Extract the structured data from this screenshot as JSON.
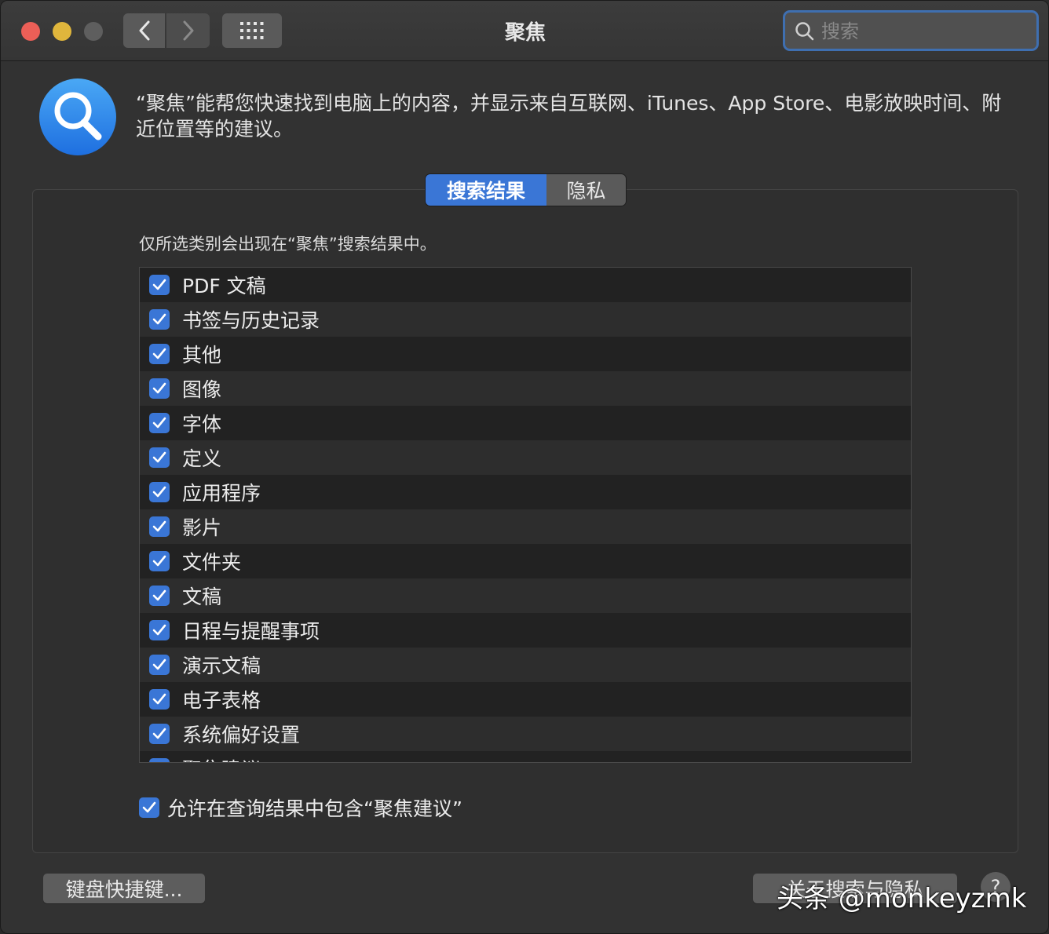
{
  "window": {
    "title": "聚焦"
  },
  "search": {
    "placeholder": "搜索",
    "value": ""
  },
  "header": {
    "description": "“聚焦”能帮您快速找到电脑上的内容，并显示来自互联网、iTunes、App Store、电影放映时间、附近位置等的建议。"
  },
  "tabs": [
    {
      "label": "搜索结果",
      "selected": true
    },
    {
      "label": "隐私",
      "selected": false
    }
  ],
  "results": {
    "hint": "仅所选类别会出现在“聚焦”搜索结果中。",
    "items": [
      {
        "label": "PDF 文稿",
        "checked": true
      },
      {
        "label": "书签与历史记录",
        "checked": true
      },
      {
        "label": "其他",
        "checked": true
      },
      {
        "label": "图像",
        "checked": true
      },
      {
        "label": "字体",
        "checked": true
      },
      {
        "label": "定义",
        "checked": true
      },
      {
        "label": "应用程序",
        "checked": true
      },
      {
        "label": "影片",
        "checked": true
      },
      {
        "label": "文件夹",
        "checked": true
      },
      {
        "label": "文稿",
        "checked": true
      },
      {
        "label": "日程与提醒事项",
        "checked": true
      },
      {
        "label": "演示文稿",
        "checked": true
      },
      {
        "label": "电子表格",
        "checked": true
      },
      {
        "label": "系统偏好设置",
        "checked": true
      },
      {
        "label": "聚焦建议",
        "checked": true
      }
    ]
  },
  "allow_suggestions": {
    "label": "允许在查询结果中包含“聚焦建议”",
    "checked": true
  },
  "footer": {
    "keyboard_shortcuts": "键盘快捷键...",
    "about_privacy": "关于搜索与隐私",
    "help": "?"
  },
  "watermark": "头条 @monkeyzmk",
  "colors": {
    "accent": "#3a76d6",
    "window_bg": "#323232"
  }
}
